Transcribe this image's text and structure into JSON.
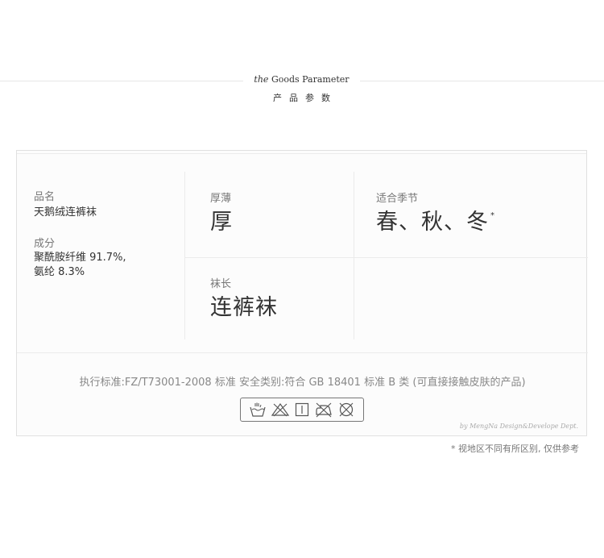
{
  "header": {
    "title_en_prefix": "the",
    "title_en_rest": "Goods Parameter",
    "title_cn": "产品参数"
  },
  "product": {
    "name_label": "品名",
    "name_value": "天鹅绒连裤袜",
    "composition_label": "成分",
    "composition_line1": "聚酰胺纤维 91.7%,",
    "composition_line2": "氨纶 8.3%",
    "thickness_label": "厚薄",
    "thickness_value": "厚",
    "season_label": "适合季节",
    "season_value": "春、秋、冬",
    "season_mark": "*",
    "length_label": "袜长",
    "length_value": "连裤袜"
  },
  "standard_text": "执行标准:FZ/T73001-2008 标准  安全类别:符合 GB 18401 标准 B 类 (可直接接触皮肤的产品)",
  "care_icons": [
    "hand-wash-icon",
    "no-bleach-icon",
    "drip-dry-icon",
    "no-iron-icon",
    "no-dry-clean-icon"
  ],
  "credit": "by MengNa Design&Develope Dept.",
  "footnote": "* 视地区不同有所区别, 仅供参考"
}
